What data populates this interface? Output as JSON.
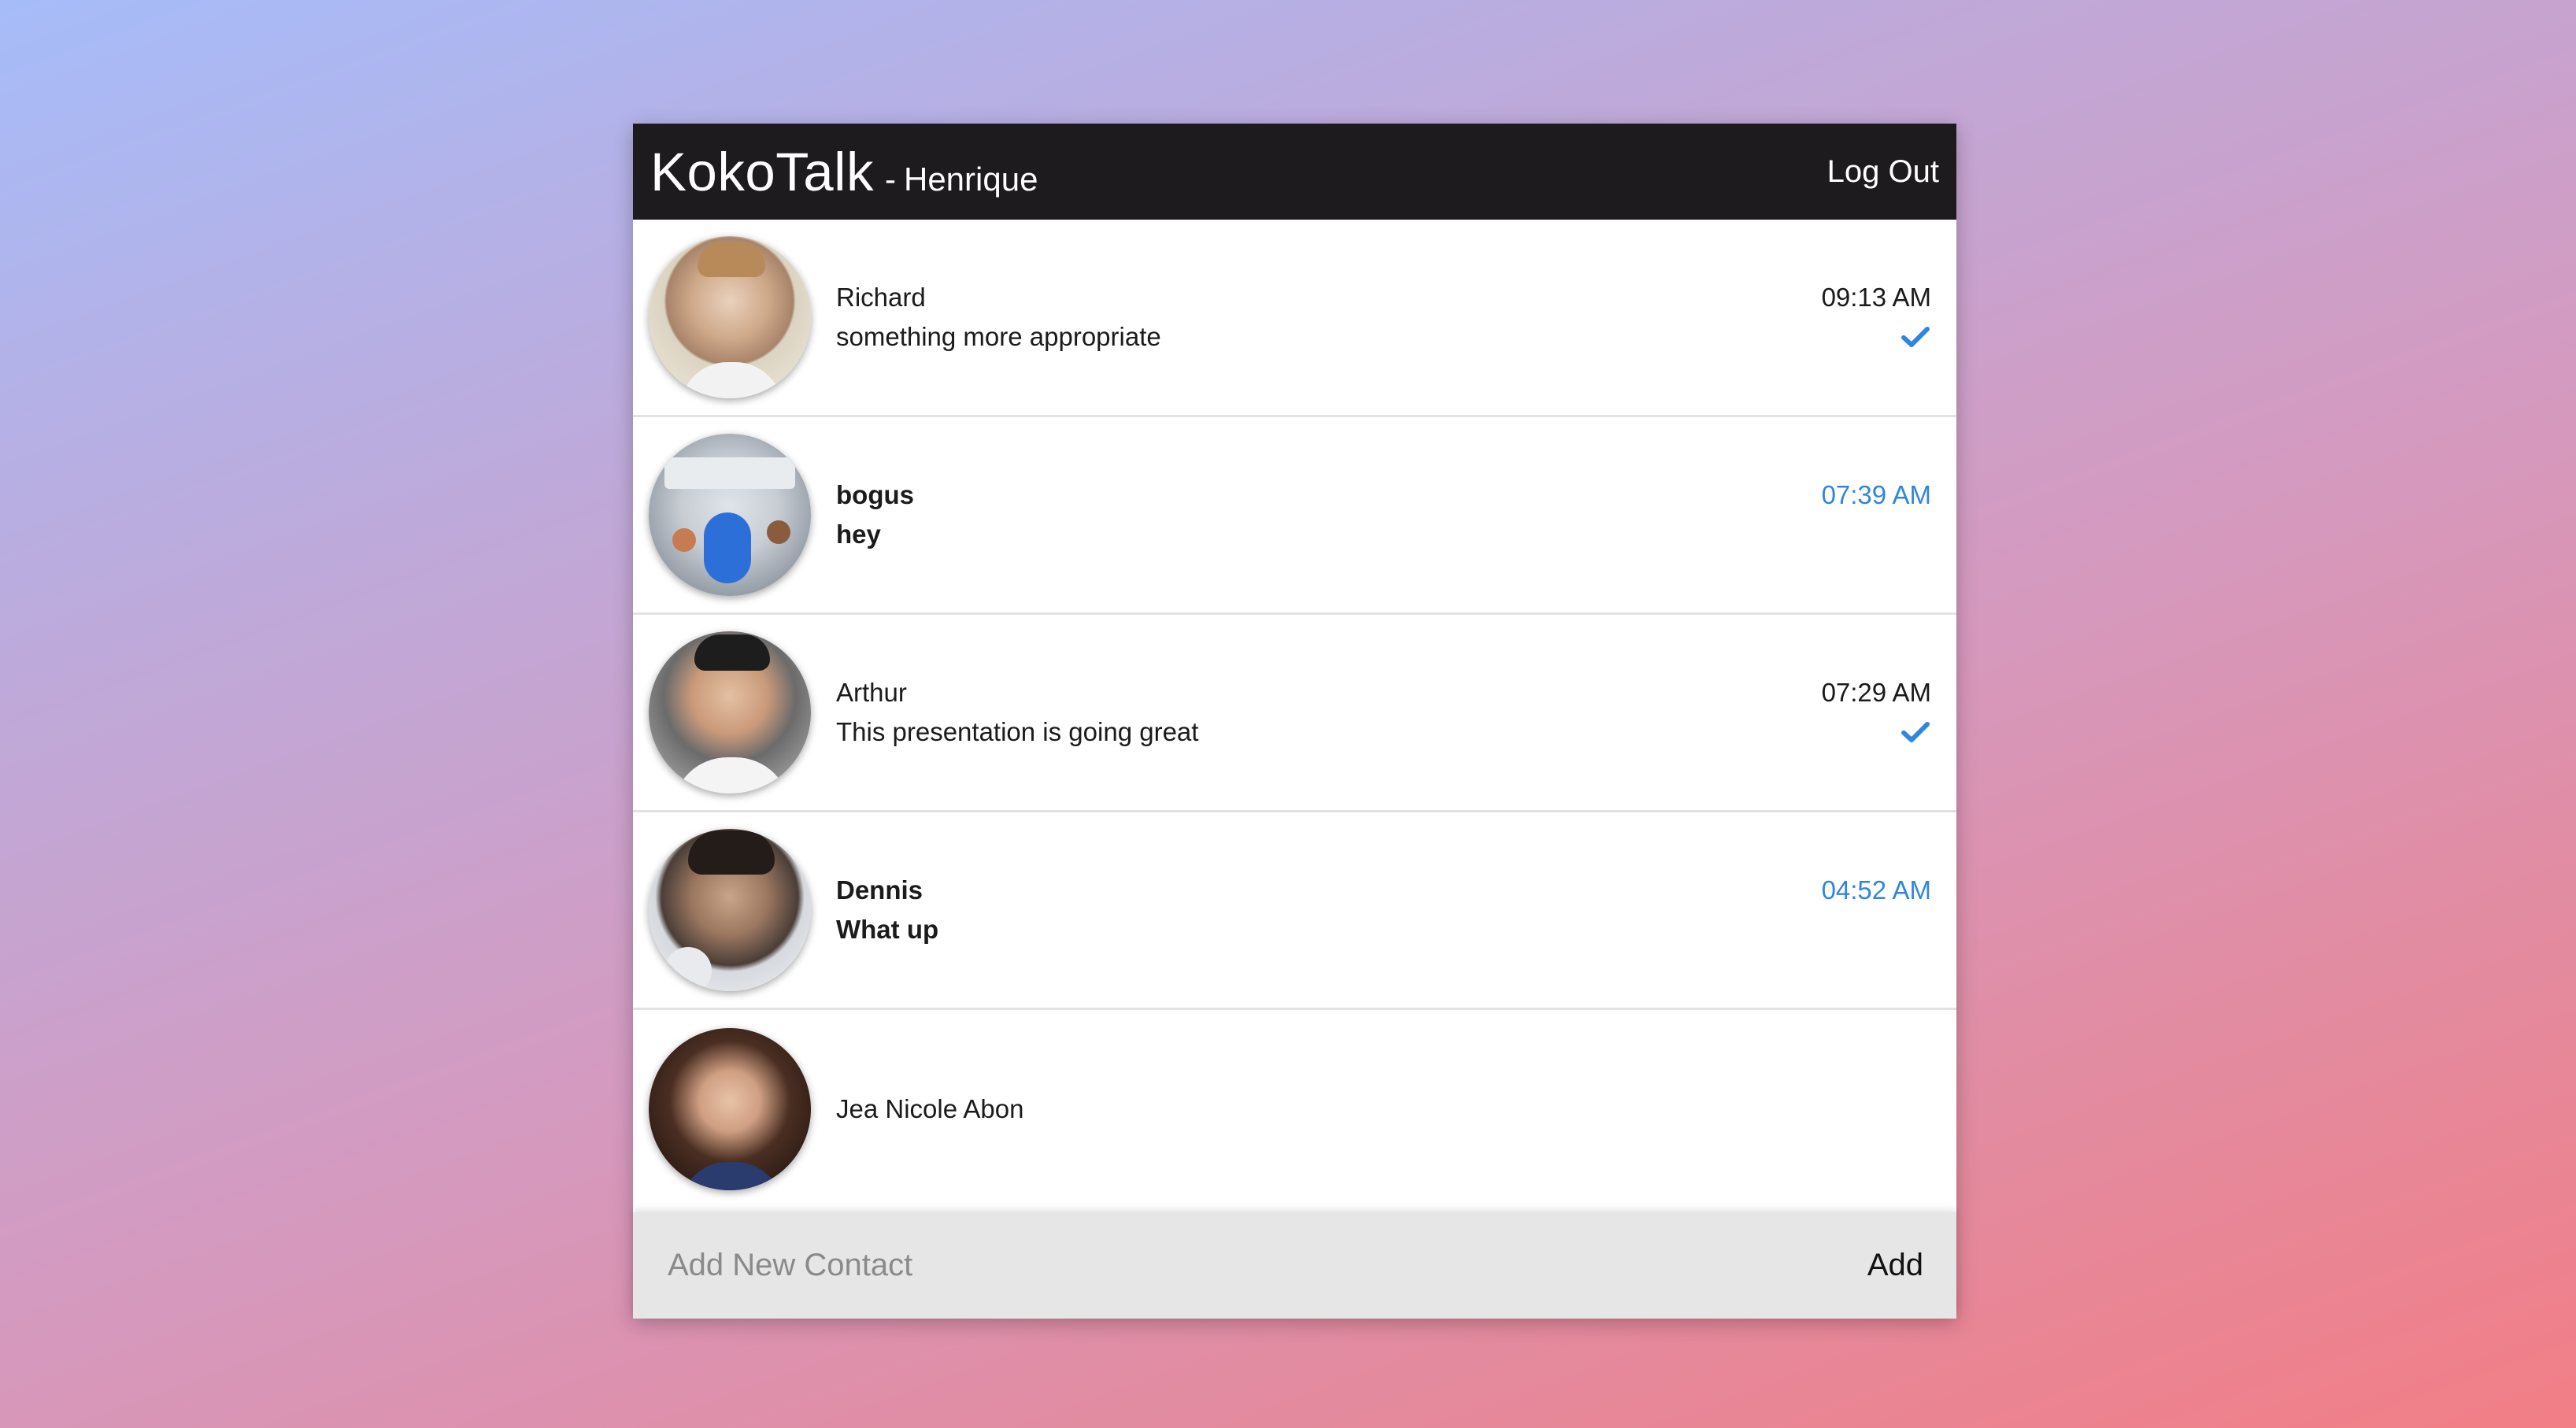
{
  "header": {
    "brand": "KokoTalk",
    "separator": "-",
    "username": "Henrique",
    "logout_label": "Log Out"
  },
  "contacts": [
    {
      "name": "Richard",
      "message": "something more appropriate",
      "time": "09:13 AM",
      "unread": false,
      "read_receipt": true,
      "avatar_icon": "avatar-photo-richard"
    },
    {
      "name": "bogus",
      "message": "hey",
      "time": "07:39 AM",
      "unread": true,
      "read_receipt": false,
      "avatar_icon": "avatar-photo-office"
    },
    {
      "name": "Arthur",
      "message": "This presentation is going great",
      "time": "07:29 AM",
      "unread": false,
      "read_receipt": true,
      "avatar_icon": "avatar-photo-arthur"
    },
    {
      "name": "Dennis",
      "message": "What up",
      "time": "04:52 AM",
      "unread": true,
      "read_receipt": false,
      "avatar_icon": "avatar-photo-dennis"
    },
    {
      "name": "Jea Nicole Abon",
      "message": "",
      "time": "",
      "unread": false,
      "read_receipt": false,
      "avatar_icon": "avatar-photo-jea"
    }
  ],
  "footer": {
    "input_value": "",
    "input_placeholder": "Add New Contact",
    "add_label": "Add"
  },
  "colors": {
    "header_bg": "#1e1b1f",
    "accent_blue": "#2f86e0",
    "footer_bg": "#e6e6e6"
  }
}
